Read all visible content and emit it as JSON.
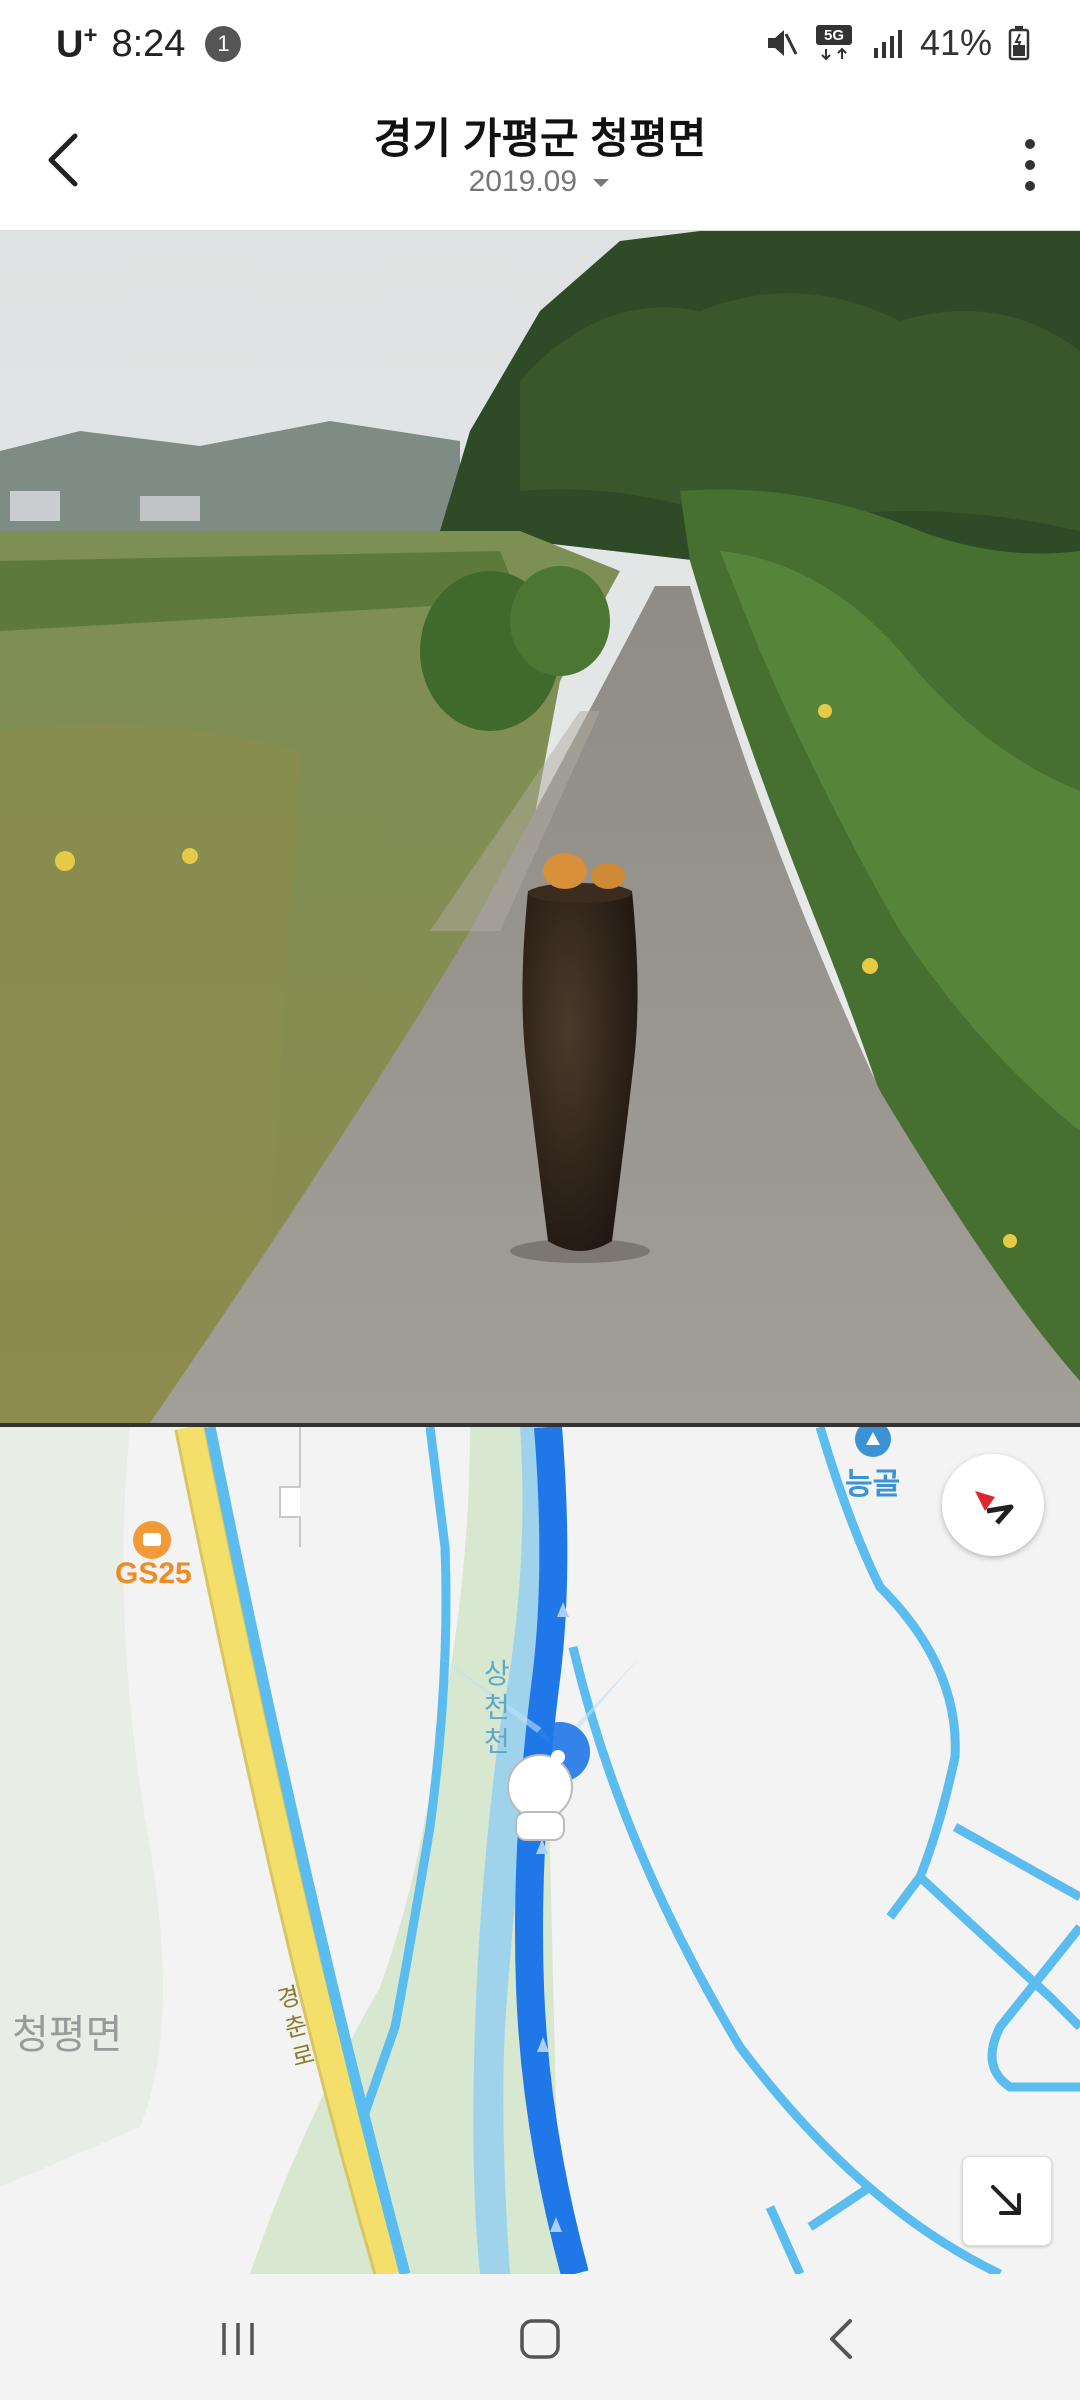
{
  "status_bar": {
    "carrier": "U",
    "carrier_sup": "+",
    "time": "8:24",
    "notification_count": "1",
    "battery": "41%"
  },
  "header": {
    "title": "경기 가평군 청평면",
    "date": "2019.09"
  },
  "map": {
    "poi_gs25": "GS25",
    "poi_neunggol": "능골",
    "river_label": "상천천",
    "road_label": "경춘로",
    "area_label": "청평면",
    "colors": {
      "route": "#1f77e8",
      "road_blue": "#5bbcef",
      "highway": "#f3df6a",
      "park": "#d8e7cf",
      "water": "#9fd3ec"
    }
  },
  "icons": {
    "back": "chevron-left-icon",
    "more": "more-vertical-icon",
    "compass": "compass-icon",
    "expand": "arrow-down-right-icon"
  }
}
